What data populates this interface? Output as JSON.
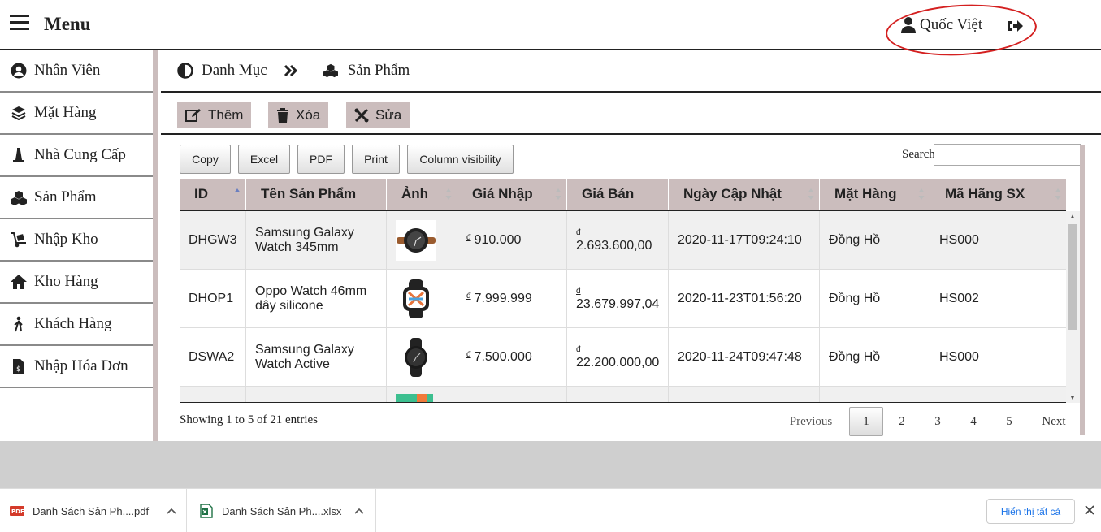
{
  "header": {
    "menu_title": "Menu",
    "user_name": "Quốc Việt"
  },
  "sidebar": {
    "items": [
      {
        "label": "Nhân Viên",
        "icon": "user-circle-icon"
      },
      {
        "label": "Mặt Hàng",
        "icon": "layers-icon"
      },
      {
        "label": "Nhà Cung Cấp",
        "icon": "building-icon"
      },
      {
        "label": "Sản Phẩm",
        "icon": "cubes-icon"
      },
      {
        "label": "Nhập Kho",
        "icon": "dolly-icon"
      },
      {
        "label": "Kho Hàng",
        "icon": "home-icon"
      },
      {
        "label": "Khách Hàng",
        "icon": "walking-person-icon"
      },
      {
        "label": "Nhập Hóa Đơn",
        "icon": "invoice-icon"
      }
    ]
  },
  "breadcrumb": {
    "first": "Danh Mục",
    "second": "Sản Phẩm"
  },
  "actions": {
    "add": "Thêm",
    "delete": "Xóa",
    "edit": "Sửa"
  },
  "dt_buttons": {
    "copy": "Copy",
    "excel": "Excel",
    "pdf": "PDF",
    "print": "Print",
    "colvis": "Column visibility"
  },
  "search": {
    "label": "Search:",
    "value": ""
  },
  "table": {
    "columns": [
      "ID",
      "Tên Sản Phẩm",
      "Ảnh",
      "Giá Nhập",
      "Giá Bán",
      "Ngày Cập Nhật",
      "Mặt Hàng",
      "Mã Hãng SX"
    ],
    "currency_symbol": "đ",
    "rows": [
      {
        "id": "DHGW3",
        "name": "Samsung Galaxy Watch 345mm",
        "import_price": "910.000",
        "sell_price": "2.693.600,00",
        "updated": "2020-11-17T09:24:10",
        "category": "Đồng Hồ",
        "maker": "HS000"
      },
      {
        "id": "DHOP1",
        "name": "Oppo Watch 46mm dây silicone",
        "import_price": "7.999.999",
        "sell_price": "23.679.997,04",
        "updated": "2020-11-23T01:56:20",
        "category": "Đồng Hồ",
        "maker": "HS002"
      },
      {
        "id": "DSWA2",
        "name": "Samsung Galaxy Watch Active",
        "import_price": "7.500.000",
        "sell_price": "22.200.000,00",
        "updated": "2020-11-24T09:47:48",
        "category": "Đồng Hồ",
        "maker": "HS000"
      }
    ]
  },
  "footer": {
    "info": "Showing 1 to 5 of 21 entries",
    "previous": "Previous",
    "next": "Next",
    "pages": [
      "1",
      "2",
      "3",
      "4",
      "5"
    ]
  },
  "downloads": {
    "items": [
      {
        "name": "Danh Sách Sản Ph....pdf",
        "type": "pdf"
      },
      {
        "name": "Danh Sách Sản Ph....xlsx",
        "type": "xlsx"
      }
    ],
    "show_all": "Hiển thị tất cả"
  },
  "colors": {
    "accent": "#cbbdbd",
    "annotation": "#d42020",
    "link": "#1a73e8"
  }
}
